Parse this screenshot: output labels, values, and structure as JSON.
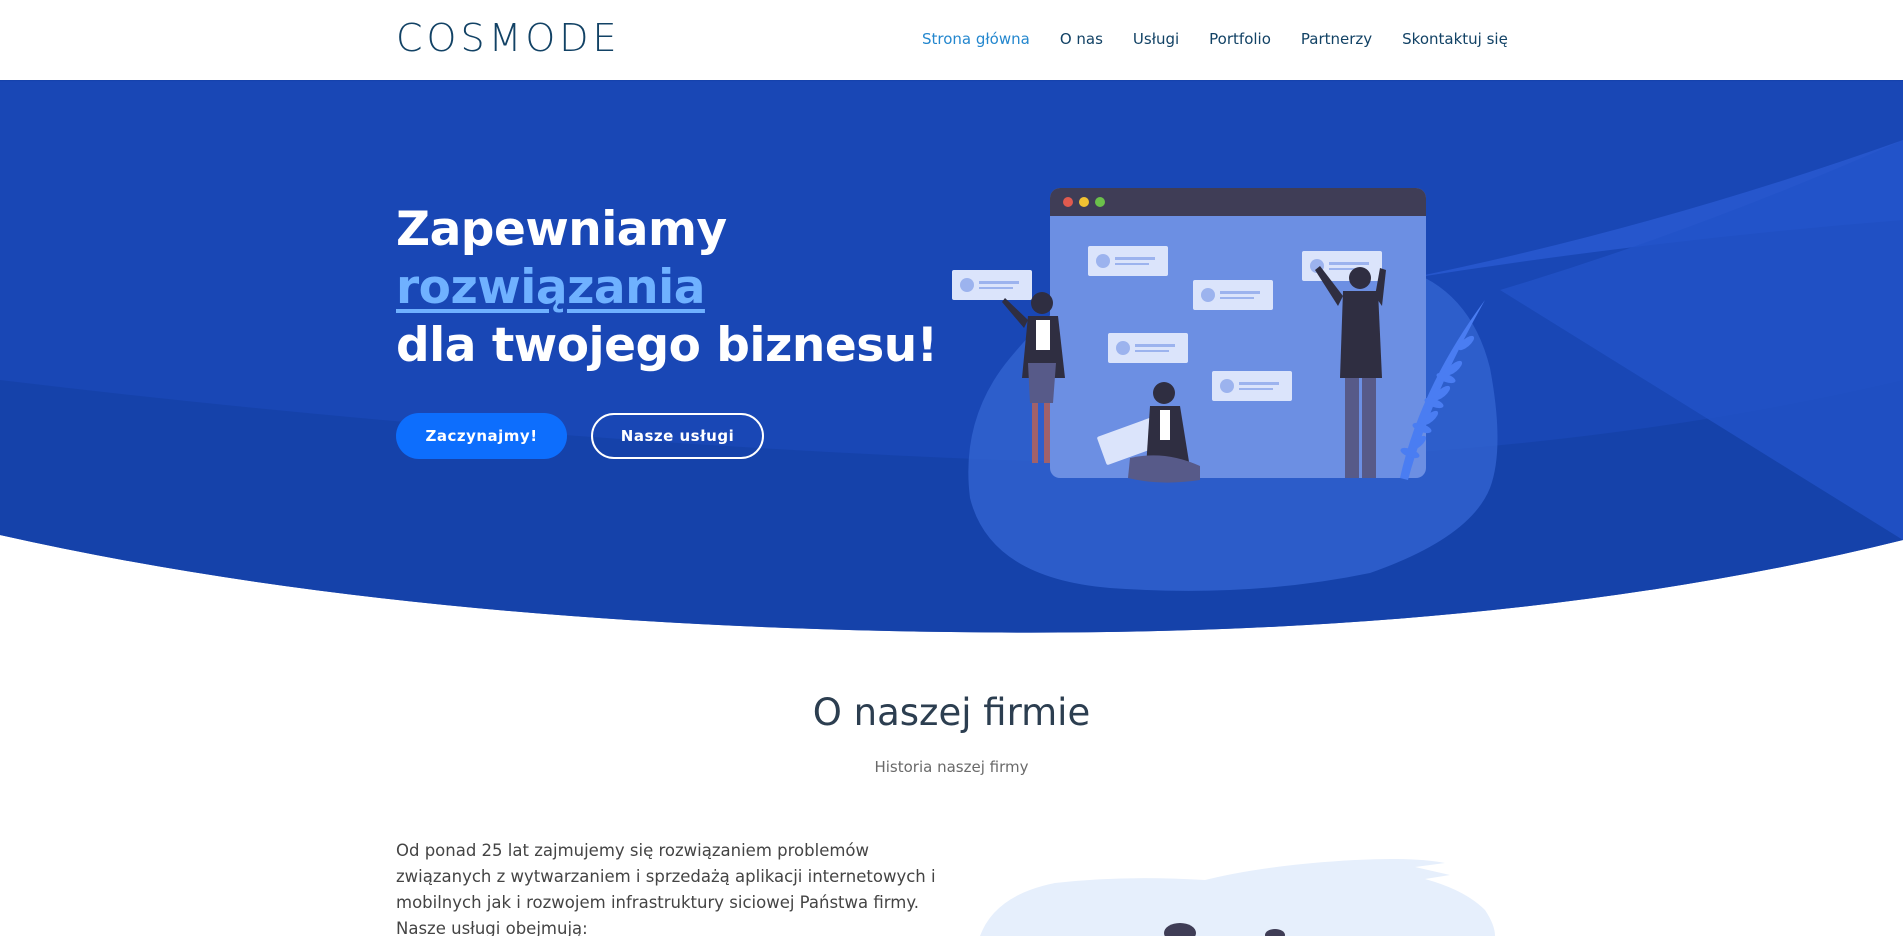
{
  "header": {
    "logo": "COSMODE",
    "nav": [
      "Strona główna",
      "O nas",
      "Usługi",
      "Portfolio",
      "Partnerzy",
      "Skontaktuj się"
    ]
  },
  "hero": {
    "title_line1": "Zapewniamy",
    "title_line2": "rozwiązania",
    "title_line3": "dla twojego biznesu!",
    "primary_button": "Zaczynajmy!",
    "secondary_button": "Nasze usługi"
  },
  "about": {
    "title": "O naszej firmie",
    "subtitle": "Historia naszej firmy",
    "body": "Od ponad 25 lat zajmujemy się rozwiązaniem problemów związanych z wytwarzaniem i sprzedażą aplikacji internetowych i mobilnych jak i rozwojem infrastruktury siciowej Państwa firmy. Nasze usługi obejmują:"
  },
  "colors": {
    "brand_dark": "#124265",
    "nav_active": "#2487ce",
    "hero_blue": "#1847b5",
    "button_blue": "#0d6efd",
    "accent_light": "#6fb1ff"
  }
}
